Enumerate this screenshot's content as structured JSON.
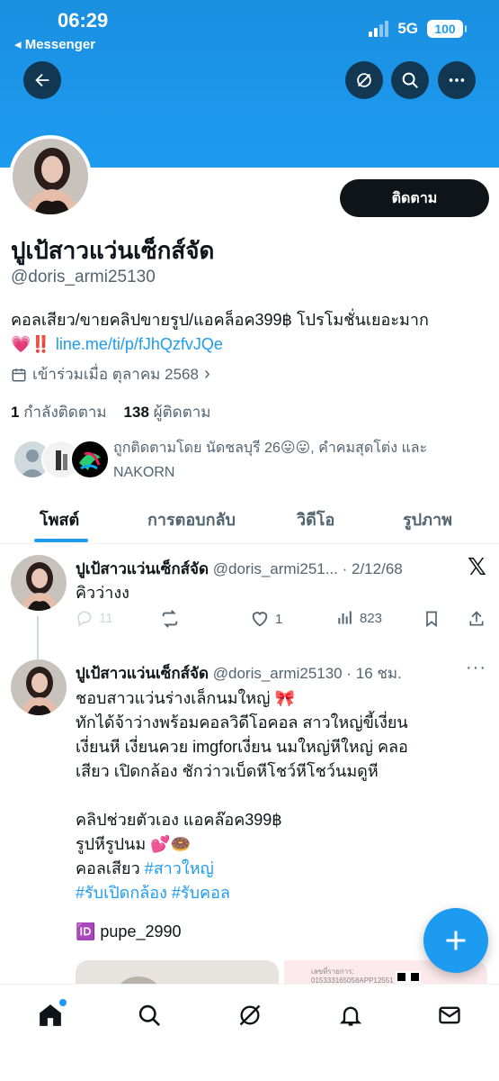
{
  "status_bar": {
    "time": "06:29",
    "back_app": "◂ Messenger",
    "network": "5G",
    "battery": "100"
  },
  "profile": {
    "name": "ปูเป้สาวแว่นเซ็กส์จัด",
    "handle": "@doris_armi25130",
    "follow_label": "ติดตาม",
    "bio_text": "คอลเสียว/ขายคลิปขายรูป/แอคล็อค399฿ โปรโมชั่นเยอะมาก",
    "bio_emoji": "💗‼️",
    "bio_link": "line.me/ti/p/fJhQzfvJQe",
    "joined": "เข้าร่วมเมื่อ ตุลาคม 2568",
    "following_count": "1",
    "following_label": "กำลังติดตาม",
    "followers_count": "138",
    "followers_label": "ผู้ติดตาม",
    "followed_by": "ถูกติดตามโดย นัดชลบุรี 26😛😛, คำคมสุดโต่ง และ NAKORN"
  },
  "tabs": [
    {
      "label": "โพสต์",
      "active": true
    },
    {
      "label": "การตอบกลับ",
      "active": false
    },
    {
      "label": "วิดีโอ",
      "active": false
    },
    {
      "label": "รูปภาพ",
      "active": false
    }
  ],
  "posts": [
    {
      "name": "ปูเป้สาวแว่นเซ็กส์จัด",
      "meta": "@doris_armi251... · 2/12/68",
      "text": "คิวว่างง",
      "replies": "11",
      "reposts": "",
      "likes": "1",
      "views": "823"
    },
    {
      "name": "ปูเป้สาวแว่นเซ็กส์จัด",
      "meta": "@doris_armi25130 · 16 ชม.",
      "line1": "ชอบสาวแว่นร่างเล็กนมใหญ่ 🎀",
      "line2": "ทักได้จ้าว่างพร้อมคอลวิดีโอคอล สาวใหญ่ขี้เงี่ยน",
      "line3": "เงี่ยนหี เงี่ยนควย imgforเงี่ยน นมใหญ่หีใหญ่ คลอ",
      "line4": "เสียว เปิดกล้อง ชักว่าวเบ็ดหีโชว์หีโชว์นมดูหี",
      "line5": "คลิปช่วยตัวเอง  แอคล๊อค399฿",
      "line6": "รูปหีรูปนม 💕🍩",
      "line7_text": "คอลเสียว ",
      "line7_tag": "#สาวใหญ่",
      "line8_tag1": "#รับเปิดกล้อง",
      "line8_tag2": "#รับคอล",
      "id_line": "🆔 pupe_2990",
      "receipt_label": "เลขที่รายการ:",
      "receipt_number": "015333165058APP12551"
    }
  ],
  "colors": {
    "brand": "#1d9bf0",
    "text": "#0f1419",
    "muted": "#536471"
  }
}
